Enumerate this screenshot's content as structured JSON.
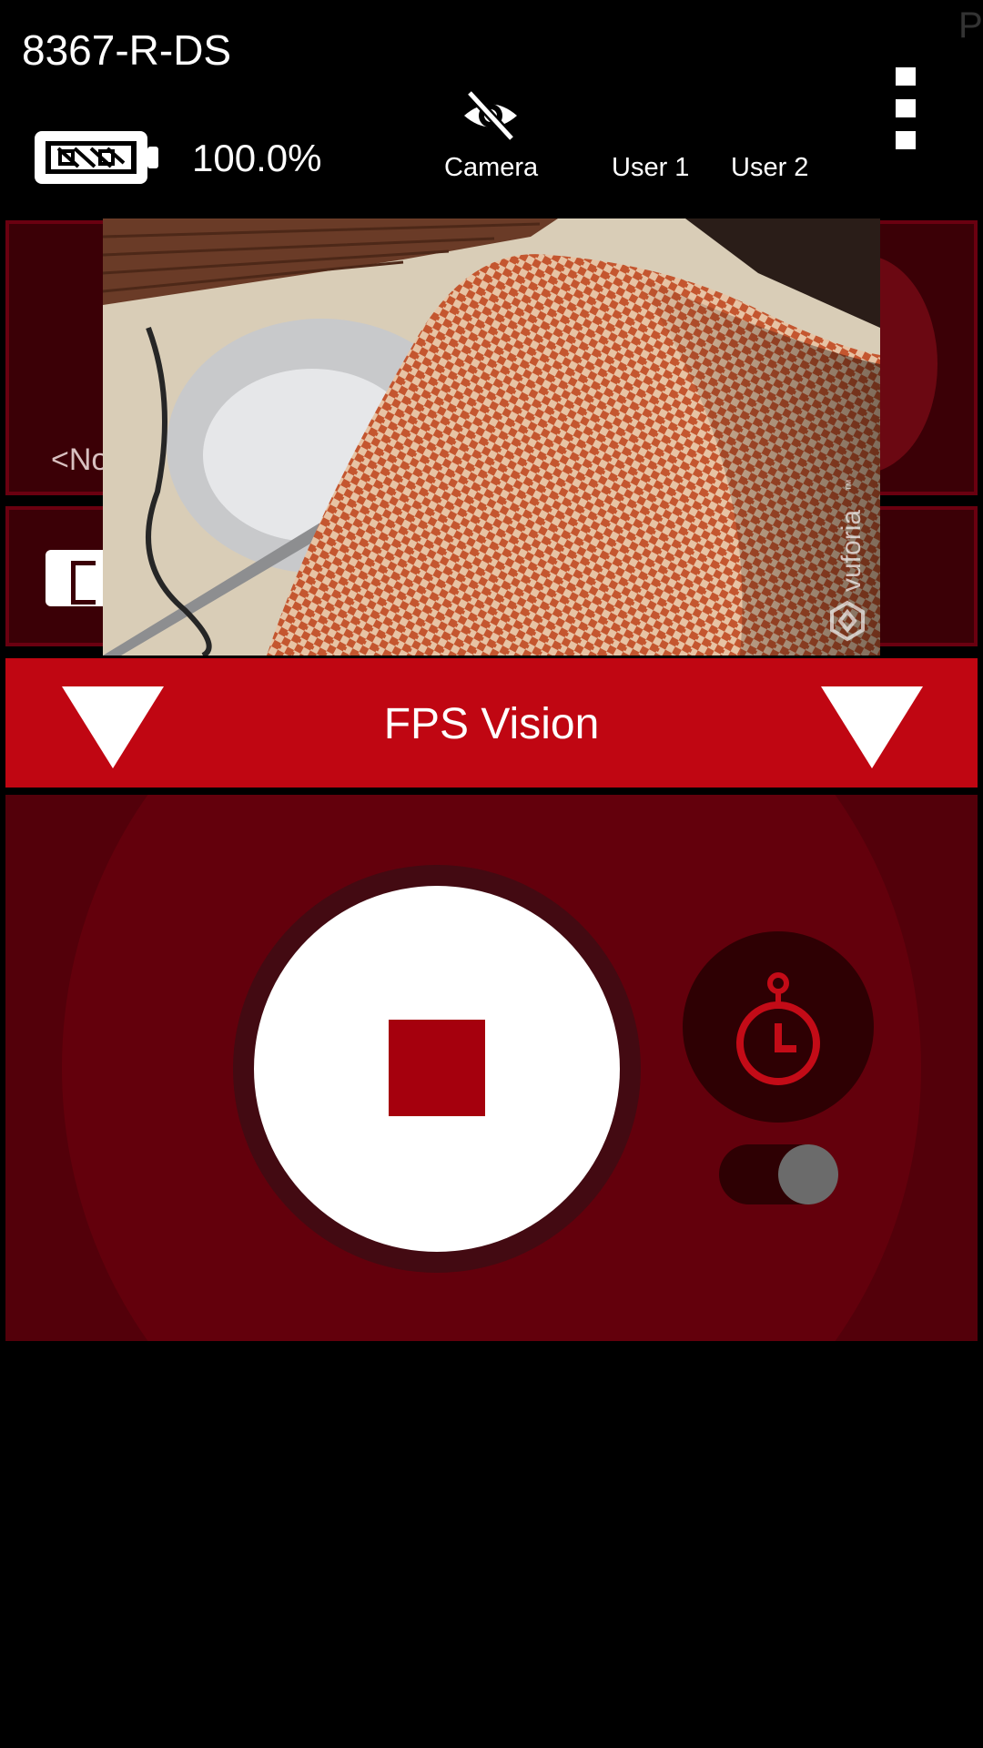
{
  "header": {
    "robot_name": "8367-R-DS",
    "corner_letter": "P",
    "battery_percent": "100.0%",
    "camera_label": "Camera",
    "user1_label": "User 1",
    "user2_label": "User 2"
  },
  "opmode_panel": {
    "selected_text": "<No"
  },
  "camera_preview": {
    "watermark": "vuforia",
    "trademark": "™"
  },
  "opmode_bar": {
    "title": "FPS Vision"
  },
  "controls": {
    "timer_enabled": true
  },
  "icons": {
    "battery": "battery-full-icon",
    "camera": "eye-off-icon",
    "menu": "more-vertical-icon",
    "left_dropdown": "triangle-down-icon",
    "right_dropdown": "triangle-down-icon",
    "stop": "stop-icon",
    "timer": "stopwatch-icon"
  },
  "colors": {
    "accent_red": "#c00612",
    "panel_dark_red": "#53000a",
    "stop_red": "#a5000d"
  }
}
